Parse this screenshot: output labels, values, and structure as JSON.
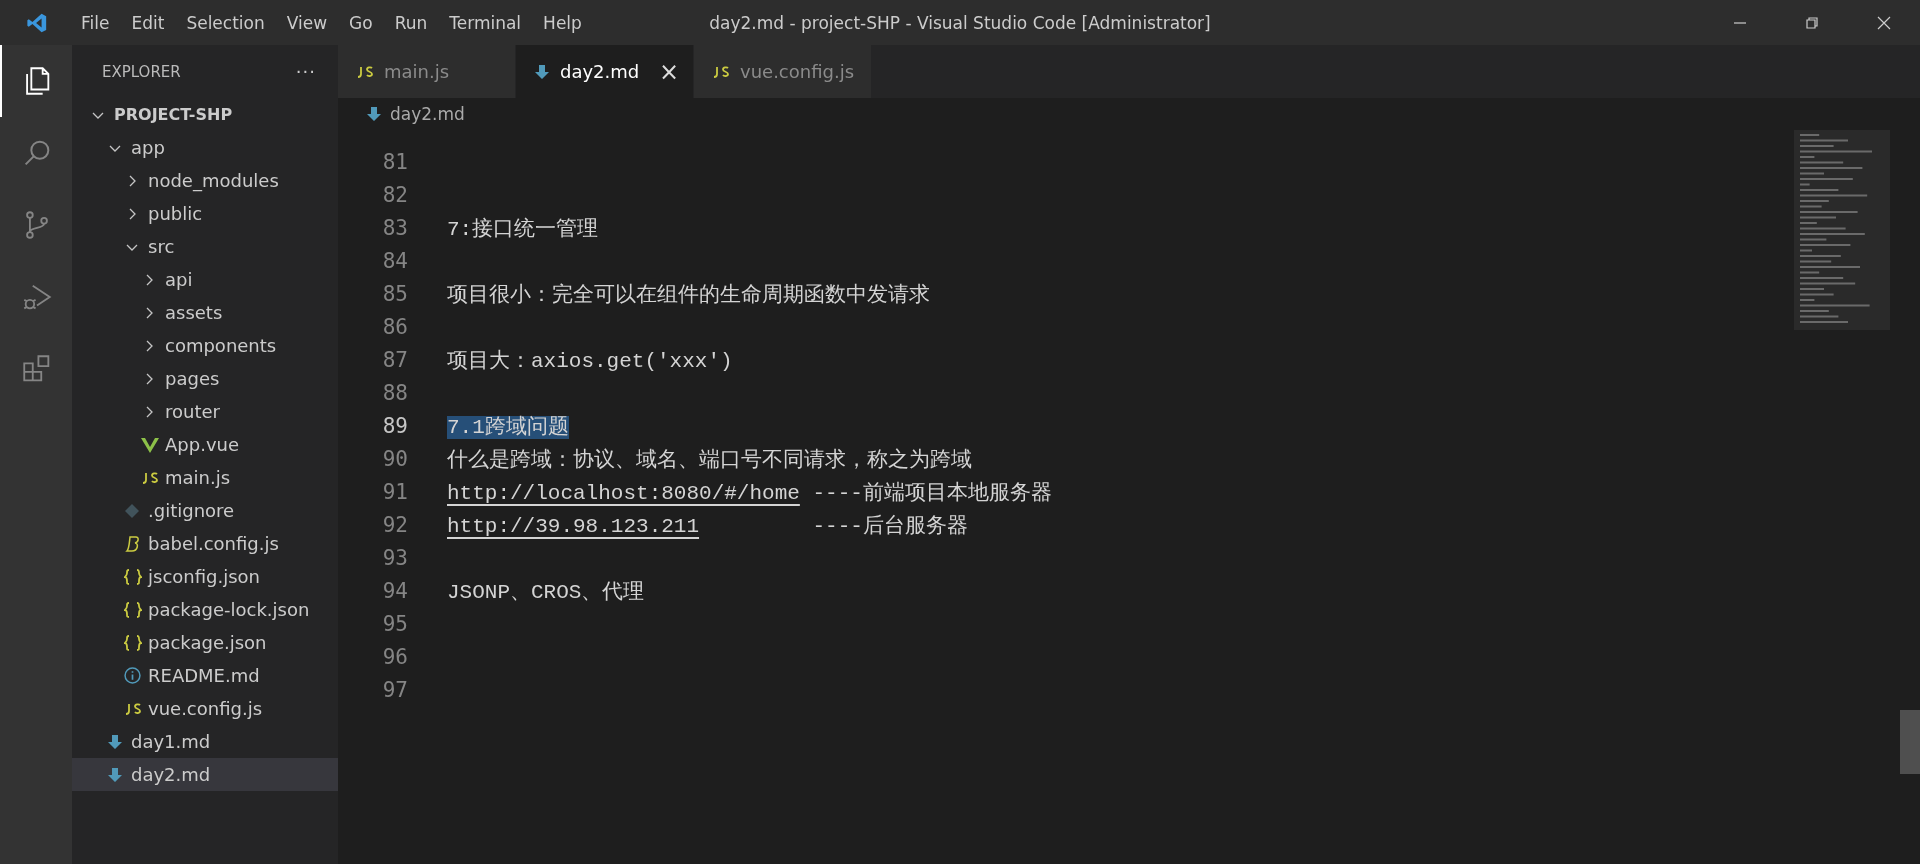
{
  "title_bar": {
    "menu": [
      "File",
      "Edit",
      "Selection",
      "View",
      "Go",
      "Run",
      "Terminal",
      "Help"
    ],
    "title": "day2.md - project-SHP - Visual Studio Code [Administrator]"
  },
  "activity_bar": [
    {
      "kind": "files",
      "selected": true
    },
    {
      "kind": "search",
      "selected": false
    },
    {
      "kind": "git",
      "selected": false
    },
    {
      "kind": "debug",
      "selected": false
    },
    {
      "kind": "extensions",
      "selected": false
    }
  ],
  "sidebar": {
    "title": "EXPLORER",
    "more": "···",
    "tree": [
      {
        "label": "PROJECT-SHP",
        "kind": "root",
        "expanded": true,
        "selected": false,
        "children": [
          {
            "label": "app",
            "kind": "folder",
            "expanded": true,
            "selected": false,
            "children": [
              {
                "label": "node_modules",
                "kind": "folder",
                "expanded": false,
                "selected": false
              },
              {
                "label": "public",
                "kind": "folder",
                "expanded": false,
                "selected": false
              },
              {
                "label": "src",
                "kind": "folder",
                "expanded": true,
                "selected": false,
                "children": [
                  {
                    "label": "api",
                    "kind": "folder",
                    "expanded": false,
                    "selected": false
                  },
                  {
                    "label": "assets",
                    "kind": "folder",
                    "expanded": false,
                    "selected": false
                  },
                  {
                    "label": "components",
                    "kind": "folder",
                    "expanded": false,
                    "selected": false
                  },
                  {
                    "label": "pages",
                    "kind": "folder",
                    "expanded": false,
                    "selected": false
                  },
                  {
                    "label": "router",
                    "kind": "folder",
                    "expanded": false,
                    "selected": false
                  },
                  {
                    "label": "App.vue",
                    "kind": "vue",
                    "selected": false
                  },
                  {
                    "label": "main.js",
                    "kind": "js",
                    "selected": false
                  }
                ]
              },
              {
                "label": ".gitignore",
                "kind": "git",
                "selected": false
              },
              {
                "label": "babel.config.js",
                "kind": "babel",
                "selected": false
              },
              {
                "label": "jsconfig.json",
                "kind": "json",
                "selected": false
              },
              {
                "label": "package-lock.json",
                "kind": "json",
                "selected": false
              },
              {
                "label": "package.json",
                "kind": "json",
                "selected": false
              },
              {
                "label": "README.md",
                "kind": "info",
                "selected": false
              },
              {
                "label": "vue.config.js",
                "kind": "js",
                "selected": false
              }
            ]
          },
          {
            "label": "day1.md",
            "kind": "md",
            "selected": false
          },
          {
            "label": "day2.md",
            "kind": "md",
            "selected": true
          }
        ]
      }
    ]
  },
  "tabs": [
    {
      "label": "main.js",
      "kind": "js",
      "selected": false
    },
    {
      "label": "day2.md",
      "kind": "md",
      "selected": true,
      "close": "×"
    },
    {
      "label": "vue.config.js",
      "kind": "js",
      "selected": false
    }
  ],
  "breadcrumb": {
    "label": "day2.md",
    "kind": "md"
  },
  "editor": {
    "lines": [
      {
        "number": "81",
        "current": false
      },
      {
        "number": "82",
        "current": false
      },
      {
        "number": "83",
        "current": false,
        "segments": [
          {
            "text": "7:接口统一管理",
            "kind": "plain"
          }
        ]
      },
      {
        "number": "84",
        "current": false
      },
      {
        "number": "85",
        "current": false,
        "segments": [
          {
            "text": "项目很小：完全可以在组件的生命周期函数中发请求",
            "kind": "plain"
          }
        ]
      },
      {
        "number": "86",
        "current": false
      },
      {
        "number": "87",
        "current": false,
        "segments": [
          {
            "text": "项目大：axios.get('xxx')",
            "kind": "plain"
          }
        ]
      },
      {
        "number": "88",
        "current": false
      },
      {
        "number": "89",
        "current": true,
        "segments": [
          {
            "text": "7.1跨域问题",
            "kind": "selection"
          }
        ]
      },
      {
        "number": "90",
        "current": false,
        "segments": [
          {
            "text": "什么是跨域：协议、域名、端口号不同请求，称之为跨域",
            "kind": "plain"
          }
        ]
      },
      {
        "number": "91",
        "current": false,
        "segments": [
          {
            "text": "http://localhost:8080/#/home",
            "kind": "link"
          },
          {
            "text": " ----前端项目本地服务器",
            "kind": "plain"
          }
        ]
      },
      {
        "number": "92",
        "current": false,
        "segments": [
          {
            "text": "http://39.98.123.211",
            "kind": "link"
          },
          {
            "text": "         ----后台服务器",
            "kind": "plain"
          }
        ]
      },
      {
        "number": "93",
        "current": false
      },
      {
        "number": "94",
        "current": false,
        "segments": [
          {
            "text": "JSONP、CROS、代理",
            "kind": "plain"
          }
        ]
      },
      {
        "number": "95",
        "current": false
      },
      {
        "number": "96",
        "current": false
      },
      {
        "number": "97",
        "current": false
      }
    ]
  }
}
